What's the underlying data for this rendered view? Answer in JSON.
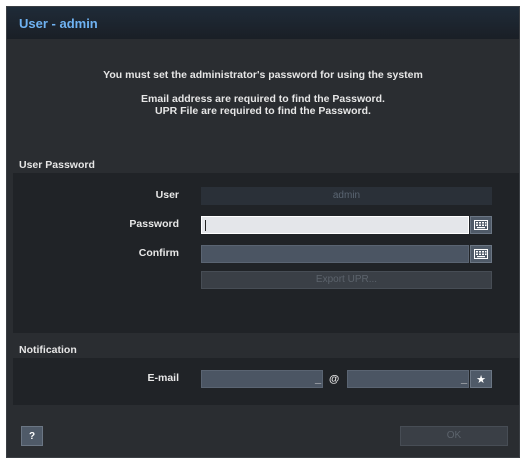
{
  "dialog": {
    "title": "User - admin",
    "message_line1": "You must set the administrator's password for using the system",
    "message_line2": "Email address are required to find the Password.",
    "message_line3": "UPR File are required to find the Password."
  },
  "user_password": {
    "section_label": "User Password",
    "user_label": "User",
    "user_value": "admin",
    "password_label": "Password",
    "password_value": "",
    "confirm_label": "Confirm",
    "confirm_value": "",
    "export_label": "Export UPR..."
  },
  "notification": {
    "section_label": "Notification",
    "email_label": "E-mail",
    "email_user_value": "",
    "email_at": "@",
    "email_domain_value": "",
    "email_suffix_user": "_",
    "email_suffix_domain": "_"
  },
  "footer": {
    "help_label": "?",
    "ok_label": "OK"
  },
  "icons": {
    "keyboard": "keyboard-icon",
    "star": "star-icon"
  },
  "colors": {
    "title": "#6fb2f2",
    "background": "#2a2d31",
    "panel": "#202327",
    "field": "#4b5563"
  }
}
